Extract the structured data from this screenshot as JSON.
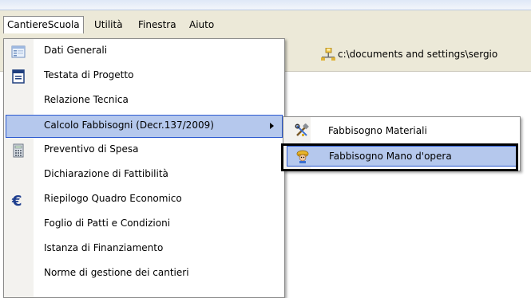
{
  "menubar": {
    "items": [
      {
        "label": "CantiereScuola",
        "active": true
      },
      {
        "label": "Utilità",
        "active": false
      },
      {
        "label": "Finestra",
        "active": false
      },
      {
        "label": "Aiuto",
        "active": false
      }
    ]
  },
  "toolbar": {
    "path_text": "c:\\documents and settings\\sergio",
    "path_icon": "network-folder-icon"
  },
  "menu": {
    "items": [
      {
        "label": "Dati Generali",
        "icon": "form-icon"
      },
      {
        "label": "Testata di Progetto",
        "icon": "document-icon"
      },
      {
        "label": "Relazione Tecnica",
        "icon": ""
      },
      {
        "label": "Calcolo Fabbisogni (Decr.137/2009)",
        "icon": "",
        "has_submenu": true,
        "highlighted": true
      },
      {
        "label": "Preventivo di Spesa",
        "icon": "calculator-icon"
      },
      {
        "label": "Dichiarazione di Fattibilità",
        "icon": ""
      },
      {
        "label": "Riepilogo Quadro Economico",
        "icon": "euro-icon"
      },
      {
        "label": "Foglio di Patti e Condizioni",
        "icon": ""
      },
      {
        "label": "Istanza di Finanziamento",
        "icon": ""
      },
      {
        "label": "Norme di gestione dei cantieri",
        "icon": ""
      }
    ]
  },
  "submenu": {
    "items": [
      {
        "label": "Fabbisogno Materiali",
        "icon": "tools-icon"
      },
      {
        "label": "Fabbisogno Mano d'opera",
        "icon": "worker-icon",
        "highlighted": true
      }
    ]
  },
  "colors": {
    "highlight_fill": "#b5c8ed",
    "highlight_border": "#2d5ad0",
    "menubar_bg": "#ece9d8"
  }
}
